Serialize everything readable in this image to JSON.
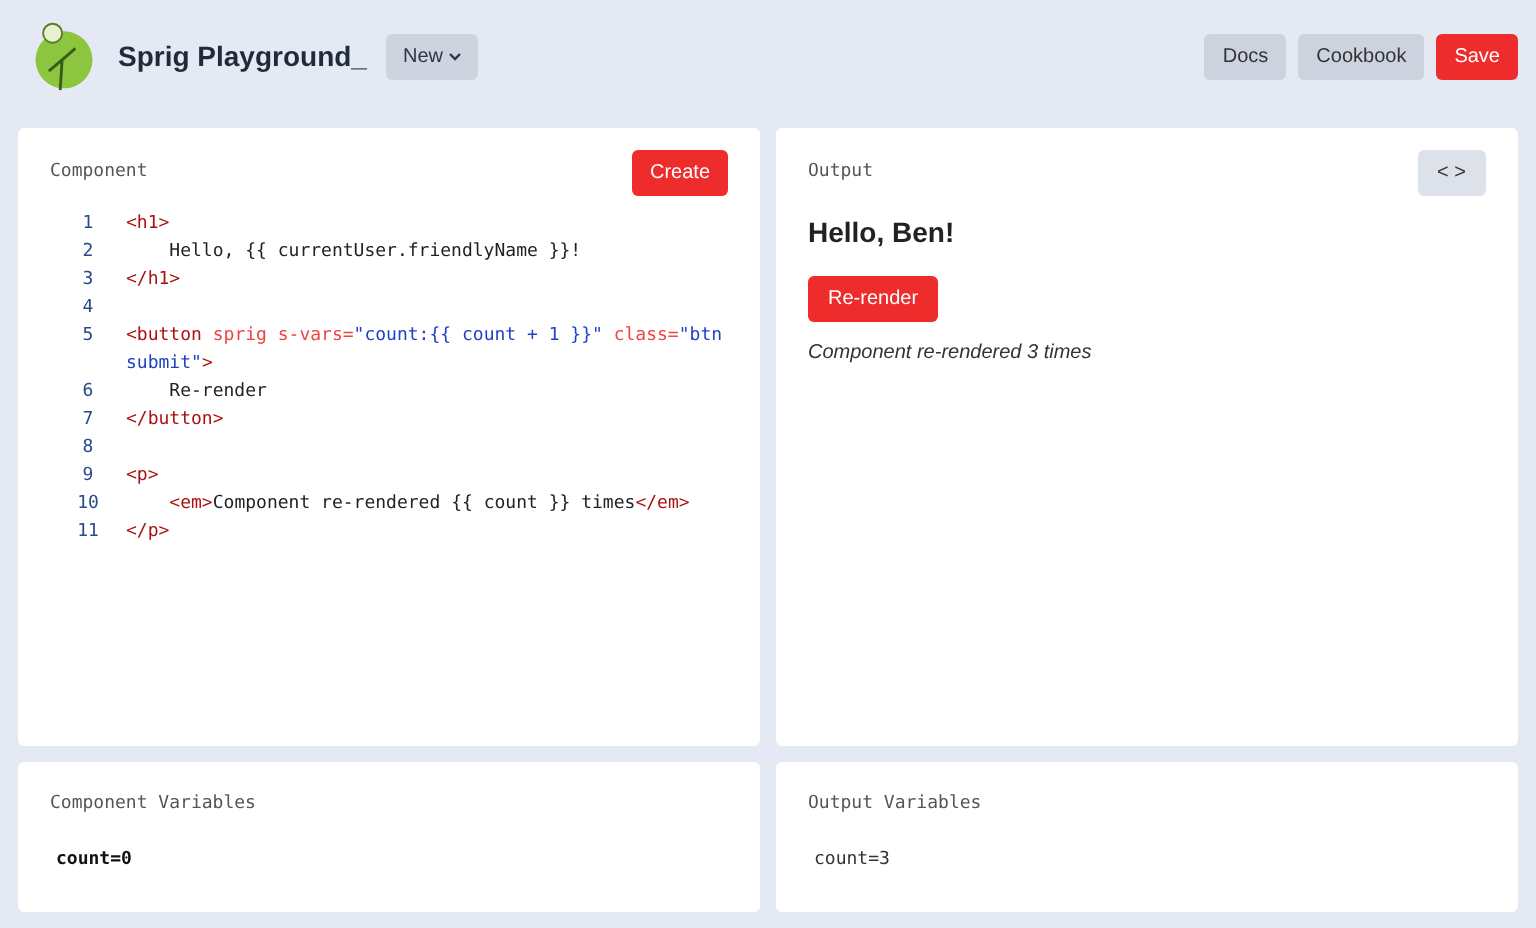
{
  "header": {
    "title": "Sprig Playground_",
    "new_button": "New",
    "buttons": [
      {
        "label": "Docs",
        "kind": "plain"
      },
      {
        "label": "Cookbook",
        "kind": "plain"
      },
      {
        "label": "Save",
        "kind": "primary"
      }
    ]
  },
  "component": {
    "title": "Component",
    "create_button": "Create",
    "lines": [
      {
        "number": "1",
        "tokens": [
          {
            "kind": "tag",
            "text": "<h1>"
          }
        ]
      },
      {
        "number": "2",
        "indent": true,
        "tokens": [
          {
            "kind": "text",
            "text": "Hello, {{ currentUser.friendlyName }}!"
          }
        ]
      },
      {
        "number": "3",
        "tokens": [
          {
            "kind": "tag",
            "text": "</h1>"
          }
        ]
      },
      {
        "number": "4"
      },
      {
        "number": "5",
        "tokens": [
          {
            "kind": "tag",
            "text": "<button"
          },
          {
            "kind": "attr",
            "text": " sprig s-vars="
          },
          {
            "kind": "string",
            "text": "\"count:{{ count + 1 }}\""
          },
          {
            "kind": "attr",
            "text": " class="
          },
          {
            "kind": "string",
            "text": "\"btn submit\""
          },
          {
            "kind": "tag",
            "text": ">"
          }
        ]
      },
      {
        "number": "6",
        "indent": true,
        "tokens": [
          {
            "kind": "text",
            "text": "Re-render"
          }
        ]
      },
      {
        "number": "7",
        "tokens": [
          {
            "kind": "tag",
            "text": "</button>"
          }
        ]
      },
      {
        "number": "8"
      },
      {
        "number": "9",
        "tokens": [
          {
            "kind": "tag",
            "text": "<p>"
          }
        ]
      },
      {
        "number": "10",
        "indent": true,
        "tokens": [
          {
            "kind": "tag",
            "text": "<em>"
          },
          {
            "kind": "text",
            "text": "Component re-rendered {{ count }} times"
          },
          {
            "kind": "tag",
            "text": "</em>"
          }
        ]
      },
      {
        "number": "11",
        "tokens": [
          {
            "kind": "tag",
            "text": "</p>"
          }
        ]
      }
    ]
  },
  "output": {
    "title": "Output",
    "toggle_button": "< >",
    "heading": "Hello, Ben!",
    "button": "Re-render",
    "message": "Component re-rendered 3 times"
  },
  "component_variables": {
    "title": "Component Variables",
    "value": "count=0"
  },
  "output_variables": {
    "title": "Output Variables",
    "value": "count=3"
  }
}
